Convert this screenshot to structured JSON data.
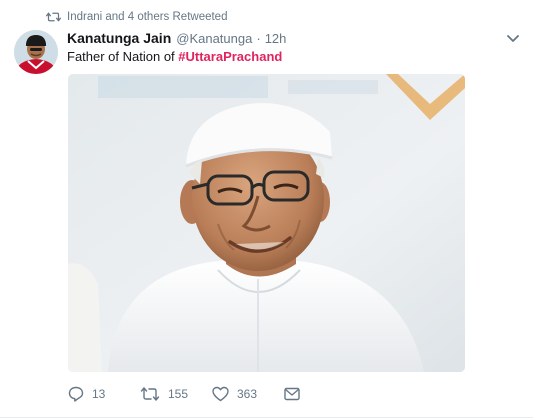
{
  "retweet_context": {
    "icon": "retweet-icon",
    "text": "Indrani and 4 others Retweeted"
  },
  "tweet": {
    "author": {
      "fullname": "Kanatunga Jain",
      "username": "@Kanatunga",
      "avatar_icon": "avatar-image"
    },
    "separator": "·",
    "time": "12h",
    "text": {
      "prefix": "Father of Nation of ",
      "hashtag": "#UttaraPrachand"
    },
    "media": {
      "kind": "photo",
      "description_icon": "photo-image"
    },
    "actions": {
      "reply": {
        "icon": "reply-icon",
        "count": "13"
      },
      "retweet": {
        "icon": "retweet-icon",
        "count": "155"
      },
      "like": {
        "icon": "heart-icon",
        "count": "363"
      },
      "message": {
        "icon": "envelope-icon"
      }
    }
  },
  "colors": {
    "text_primary": "#14171a",
    "text_secondary": "#657786",
    "hashtag": "#e0245e",
    "divider": "#e6ecf0"
  }
}
